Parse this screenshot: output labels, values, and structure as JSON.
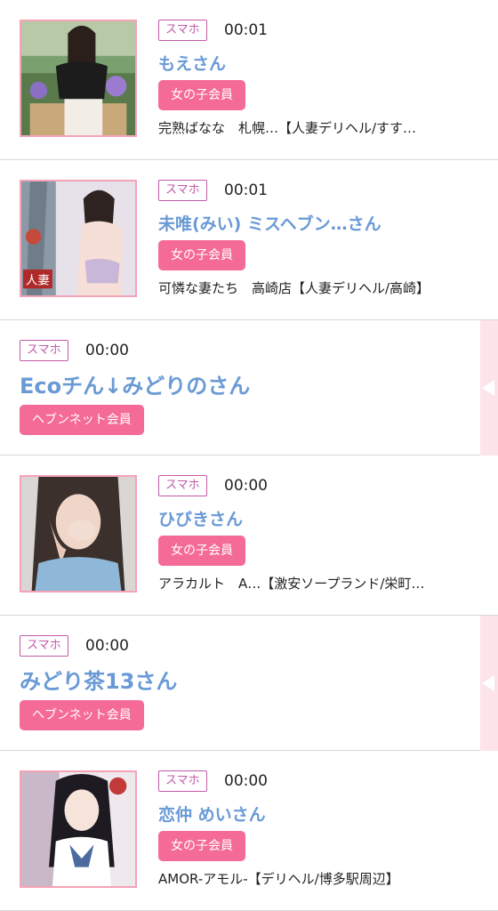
{
  "entries": [
    {
      "device": "スマホ",
      "time": "00:01",
      "name": "もえさん",
      "member": "女の子会員",
      "shop": "完熟ばなな　札幌…【人妻デリヘル/すす…"
    },
    {
      "device": "スマホ",
      "time": "00:01",
      "name": "未唯(みい) ミスヘブン…さん",
      "member": "女の子会員",
      "shop": "可憐な妻たち　高崎店【人妻デリヘル/高崎】",
      "photo_tag": "人妻"
    },
    {
      "device": "スマホ",
      "time": "00:00",
      "name": "Ecoチん↓みどりのさん",
      "member": "ヘブンネット会員"
    },
    {
      "device": "スマホ",
      "time": "00:00",
      "name": "ひびきさん",
      "member": "女の子会員",
      "shop": "アラカルト　A…【激安ソープランド/栄町…"
    },
    {
      "device": "スマホ",
      "time": "00:00",
      "name": "みどり茶13さん",
      "member": "ヘブンネット会員"
    },
    {
      "device": "スマホ",
      "time": "00:00",
      "name": "恋仲 めいさん",
      "member": "女の子会員",
      "shop": "AMOR-アモル-【デリヘル/博多駅周辺】"
    }
  ],
  "colors": {
    "accent_pink": "#f56b97",
    "badge_purple": "#c25aa8",
    "name_blue": "#6a9ad6",
    "frame_pink": "#f4a3b6"
  }
}
